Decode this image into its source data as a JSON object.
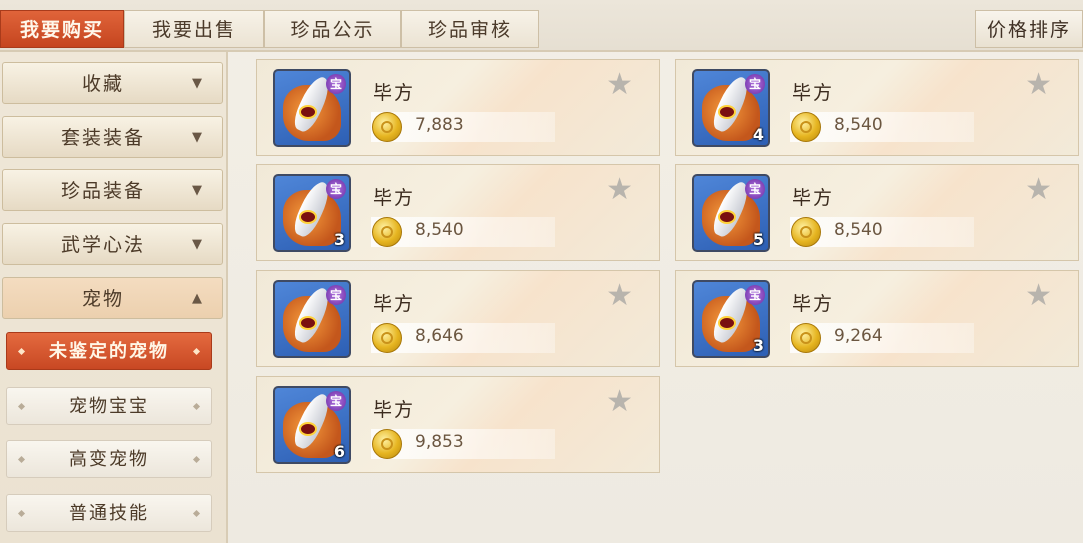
{
  "tabs": [
    {
      "label": "我要购买",
      "active": true
    },
    {
      "label": "我要出售"
    },
    {
      "label": "珍品公示"
    },
    {
      "label": "珍品审核"
    }
  ],
  "sort_label": "价格排序",
  "sidebar": {
    "categories": [
      {
        "label": "收藏",
        "arrow": "▼"
      },
      {
        "label": "套装装备",
        "arrow": "▼"
      },
      {
        "label": "珍品装备",
        "arrow": "▼"
      },
      {
        "label": "武学心法",
        "arrow": "▼"
      },
      {
        "label": "宠物",
        "arrow": "▲",
        "open": true
      }
    ],
    "subitems": [
      {
        "label": "未鉴定的宠物",
        "active": true
      },
      {
        "label": "宠物宝宝"
      },
      {
        "label": "高变宠物"
      },
      {
        "label": "普通技能"
      }
    ]
  },
  "listings": [
    {
      "name": "毕方",
      "price": "7,883",
      "qty": "",
      "badge": "宝"
    },
    {
      "name": "毕方",
      "price": "8,540",
      "qty": "4",
      "badge": "宝"
    },
    {
      "name": "毕方",
      "price": "8,540",
      "qty": "3",
      "badge": "宝"
    },
    {
      "name": "毕方",
      "price": "8,540",
      "qty": "5",
      "badge": "宝"
    },
    {
      "name": "毕方",
      "price": "8,646",
      "qty": "",
      "badge": "宝"
    },
    {
      "name": "毕方",
      "price": "9,264",
      "qty": "3",
      "badge": "宝"
    },
    {
      "name": "毕方",
      "price": "9,853",
      "qty": "6",
      "badge": "宝"
    }
  ],
  "icons": {
    "favorite": "star-icon",
    "currency": "gold-coin-icon",
    "pet": "bifang-pet-icon"
  },
  "colors": {
    "accent": "#d4532b",
    "background": "#f2eee5",
    "price_text": "#6b5640"
  }
}
